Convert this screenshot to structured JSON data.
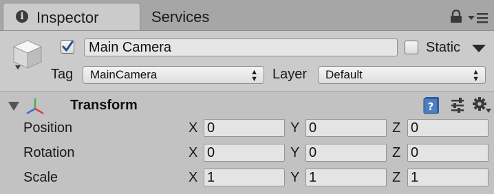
{
  "tabs": [
    {
      "label": "Inspector",
      "icon": "info-icon",
      "active": true
    },
    {
      "label": "Services",
      "active": false
    }
  ],
  "tab_icon_glyph": "i",
  "toolbar": {
    "lock": "lock-icon",
    "menu": "panel-menu-icon"
  },
  "gameobject": {
    "icon": "cube-icon",
    "active": true,
    "name": "Main Camera",
    "static_label": "Static",
    "static": false,
    "tag_label": "Tag",
    "tag_value": "MainCamera",
    "layer_label": "Layer",
    "layer_value": "Default"
  },
  "transform": {
    "title": "Transform",
    "expanded": true,
    "rows": [
      {
        "label": "Position",
        "x": "0",
        "y": "0",
        "z": "0"
      },
      {
        "label": "Rotation",
        "x": "0",
        "y": "0",
        "z": "0"
      },
      {
        "label": "Scale",
        "x": "1",
        "y": "1",
        "z": "1"
      }
    ],
    "axis_labels": {
      "x": "X",
      "y": "Y",
      "z": "Z"
    }
  },
  "colors": {
    "panel": "#cbcbcb",
    "tabbar": "#a6a6a6",
    "checkmark": "#2a4d8f",
    "help": "#4a7fc0"
  }
}
